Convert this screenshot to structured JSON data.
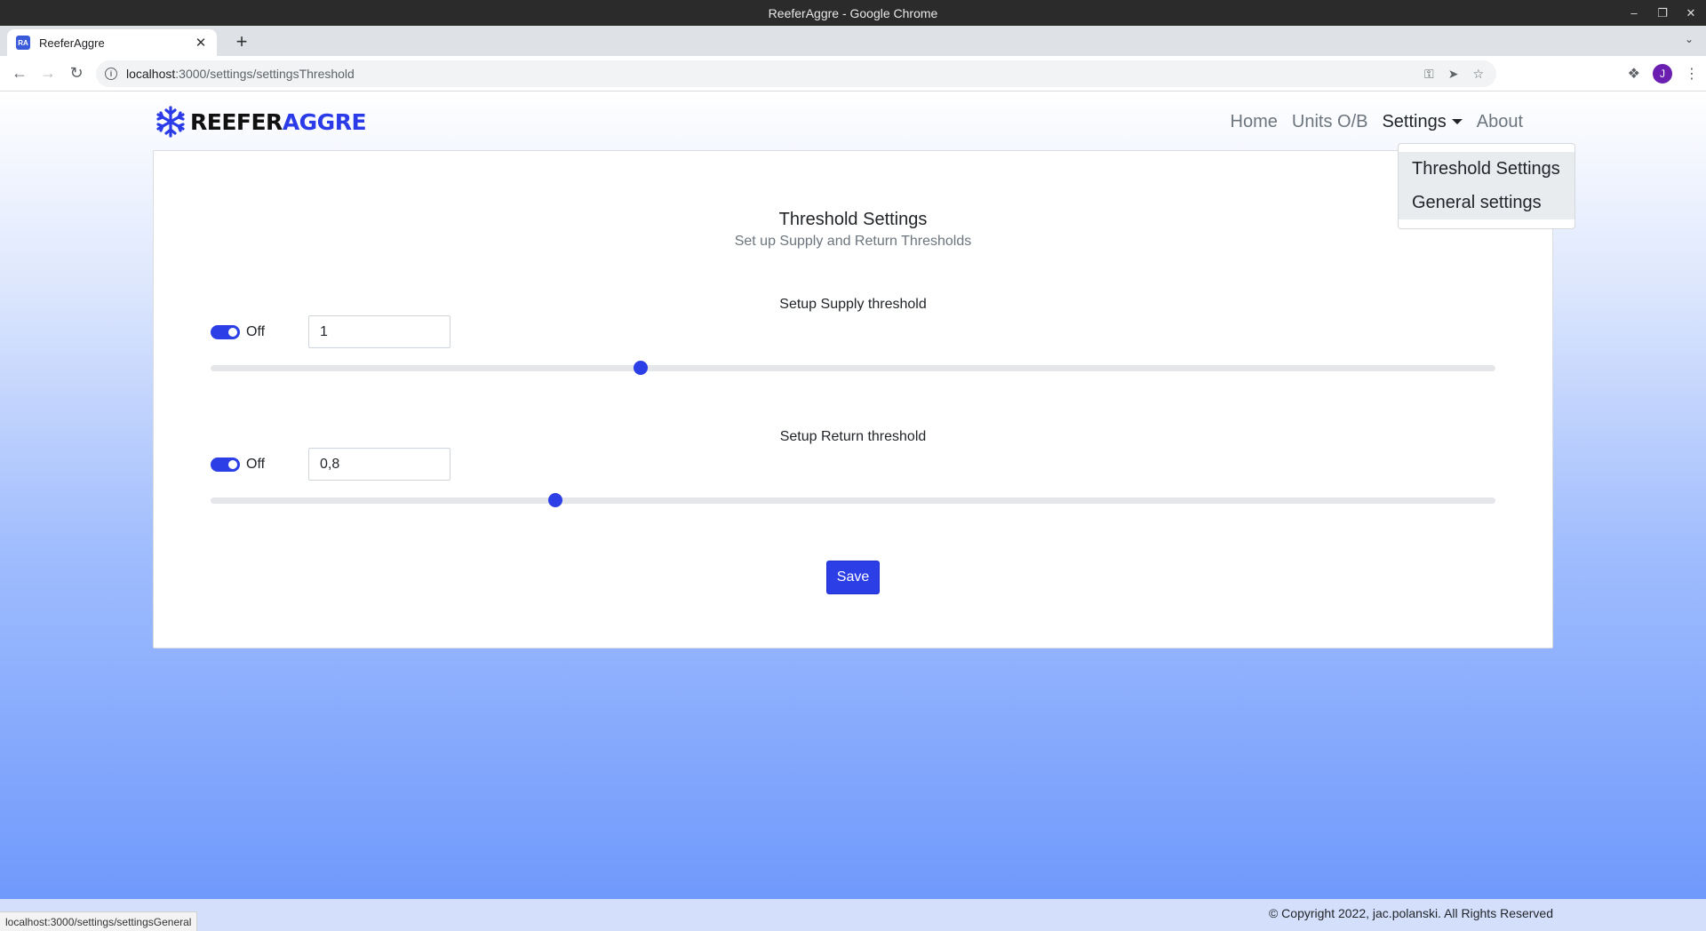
{
  "window": {
    "title": "ReeferAggre - Google Chrome"
  },
  "tab": {
    "favicon": "RA",
    "title": "ReeferAggre"
  },
  "address": {
    "host": "localhost",
    "path": ":3000/settings/settingsThreshold"
  },
  "brand": {
    "part1": "REEFER",
    "part2": "AGGRE"
  },
  "nav": {
    "home": "Home",
    "units": "Units O/B",
    "settings": "Settings",
    "about": "About"
  },
  "dropdown": {
    "item1": "Threshold Settings",
    "item2": "General settings"
  },
  "card": {
    "title": "Threshold Settings",
    "subtitle": "Set up Supply and Return Thresholds"
  },
  "supply": {
    "label": "Setup Supply threshold",
    "toggle_label": "Off",
    "toggle_on": true,
    "value": "1",
    "slider_fraction": 0.335
  },
  "return": {
    "label": "Setup Return threshold",
    "toggle_label": "Off",
    "toggle_on": true,
    "value": "0,8",
    "slider_fraction": 0.268
  },
  "save_label": "Save",
  "footer": {
    "copyright": "© Copyright 2022, jac.polanski. All Rights Reserved"
  },
  "status_bar": {
    "url": "localhost:3000/settings/settingsGeneral"
  },
  "user": {
    "avatar_initial": "J"
  },
  "colors": {
    "accent": "#2c3ee6",
    "brand_blue": "#2b3be8"
  }
}
